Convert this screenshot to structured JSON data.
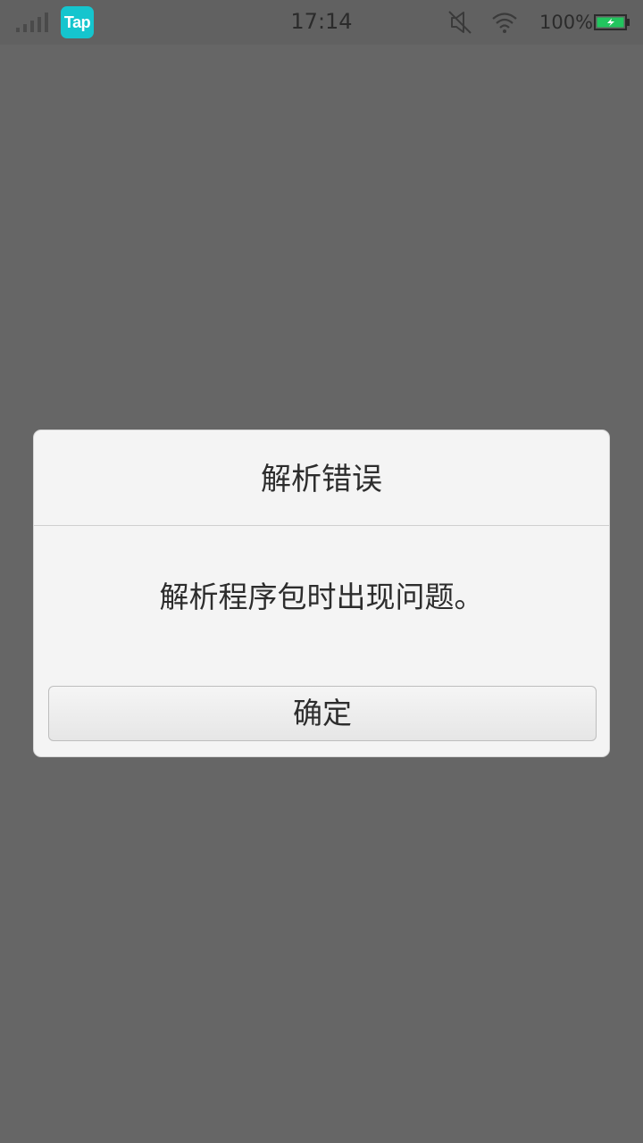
{
  "status_bar": {
    "time": "17:14",
    "battery_percent": "100%",
    "app_icon_label": "Tap",
    "icons": [
      "signal-icon",
      "tap-app-icon",
      "mute-icon",
      "wifi-icon",
      "battery-charging-icon"
    ],
    "colors": {
      "tap_icon_bg": "#15c5ce",
      "battery_fill": "#22c55e"
    }
  },
  "dialog": {
    "title": "解析错误",
    "message": "解析程序包时出现问题。",
    "ok_label": "确定"
  }
}
